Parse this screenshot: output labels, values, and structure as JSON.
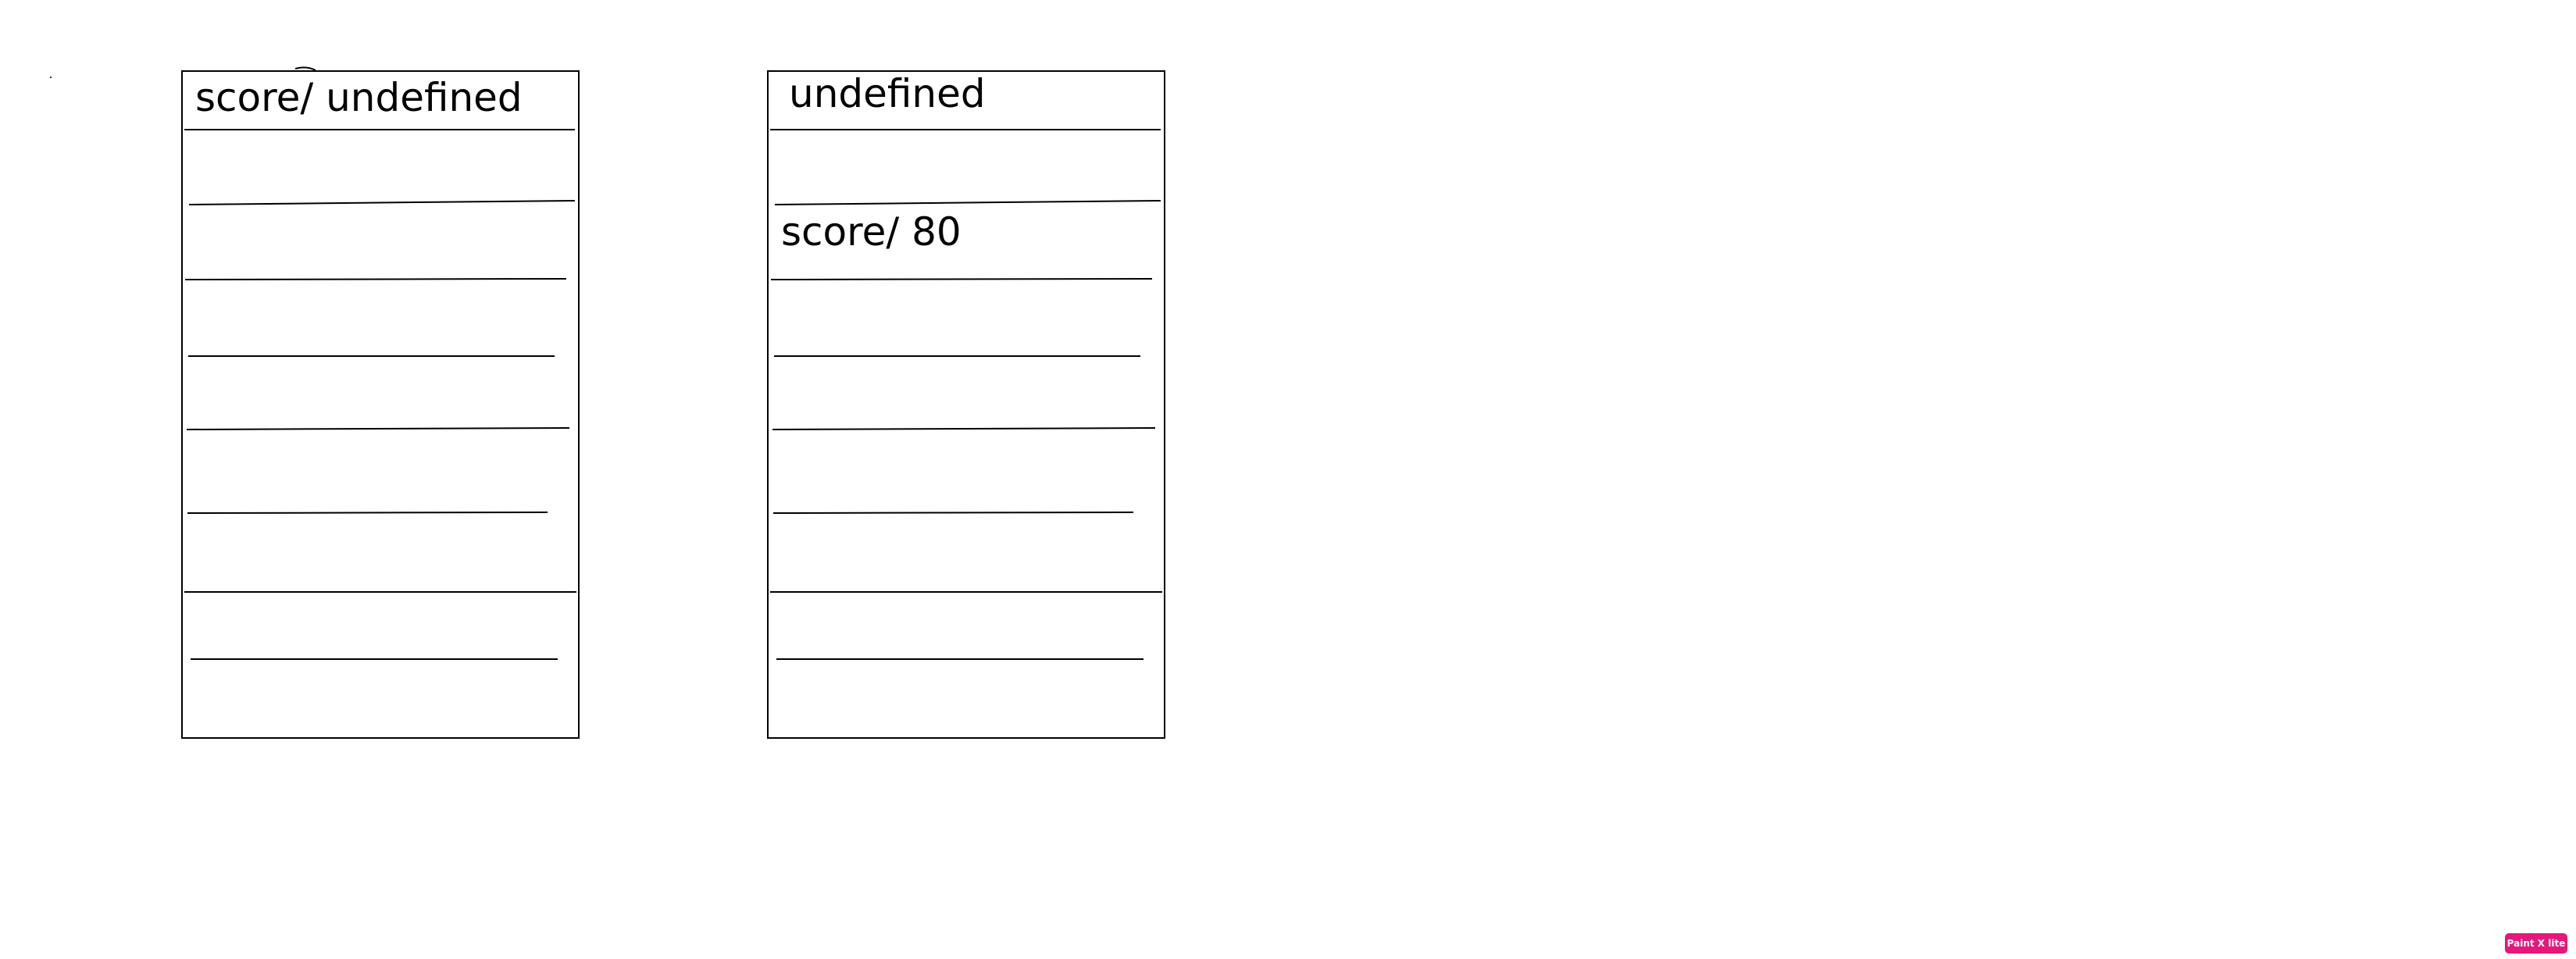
{
  "cards": [
    {
      "header_text": "score/ undefined",
      "row_texts": [
        "",
        "",
        "",
        "",
        "",
        "",
        "",
        ""
      ]
    },
    {
      "header_text": "undefined",
      "row_texts": [
        "",
        "score/ 80",
        "",
        "",
        "",
        "",
        "",
        ""
      ]
    }
  ],
  "badge": {
    "label": "Paint X lite",
    "color": "#e6177a"
  },
  "colors": {
    "background": "#ffffff",
    "stroke": "#000000"
  }
}
